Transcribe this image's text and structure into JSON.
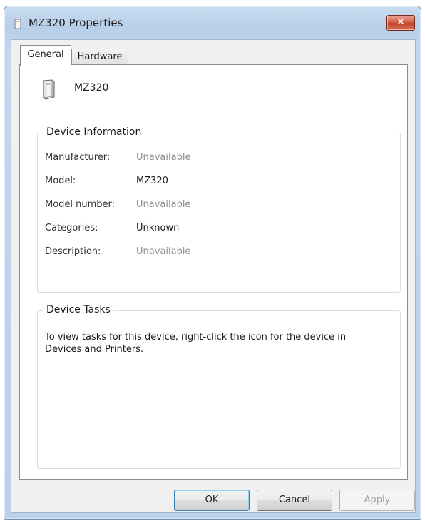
{
  "window": {
    "title": "MZ320 Properties",
    "close_label": "✕"
  },
  "tabs": [
    {
      "label": "General",
      "selected": true
    },
    {
      "label": "Hardware",
      "selected": false
    }
  ],
  "device": {
    "name": "MZ320",
    "icon": "printer-device-icon"
  },
  "device_information": {
    "heading": "Device Information",
    "rows": [
      {
        "label": "Manufacturer:",
        "value": "Unavailable",
        "available": false
      },
      {
        "label": "Model:",
        "value": "MZ320",
        "available": true
      },
      {
        "label": "Model number:",
        "value": "Unavailable",
        "available": false
      },
      {
        "label": "Categories:",
        "value": "Unknown",
        "available": true
      },
      {
        "label": "Description:",
        "value": "Unavailable",
        "available": false
      }
    ]
  },
  "device_tasks": {
    "heading": "Device Tasks",
    "text": "To view tasks for this device, right-click the icon for the device in Devices and Printers."
  },
  "buttons": {
    "ok": "OK",
    "cancel": "Cancel",
    "apply": "Apply"
  },
  "colors": {
    "title_bar": "#c9dcf1",
    "close_button": "#c0412a",
    "unavailable_text": "#8e8e8e",
    "default_button_border": "#3c7fb1"
  }
}
